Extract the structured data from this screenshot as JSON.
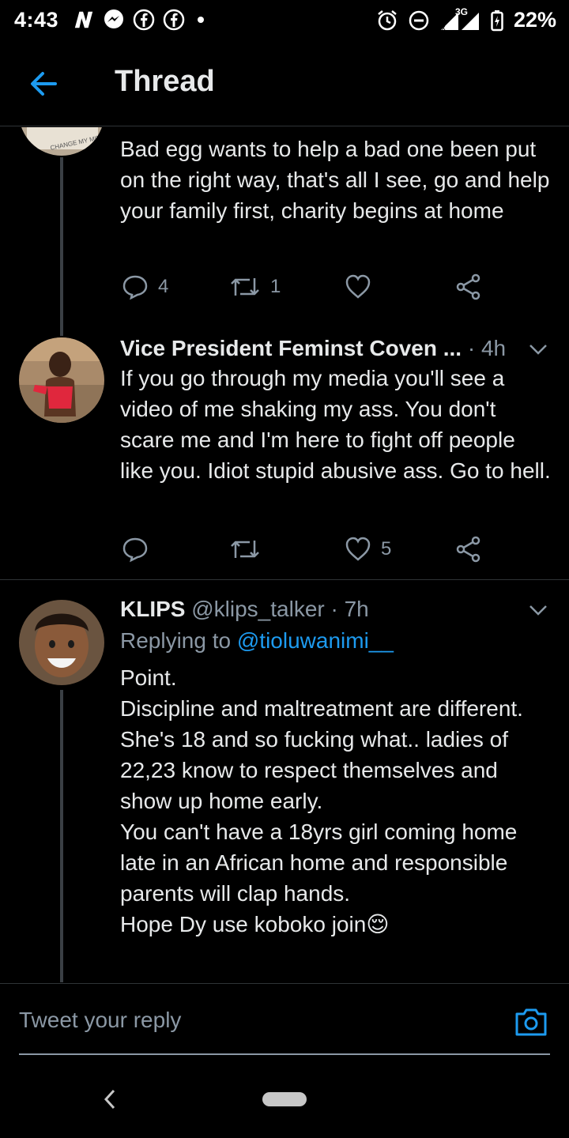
{
  "status_bar": {
    "time": "4:43",
    "network": "3G",
    "battery": "22%",
    "left_icons": [
      "n-notification-icon",
      "messenger-icon",
      "facebook-icon",
      "facebook-icon"
    ],
    "right_icons": [
      "alarm-icon",
      "dnd-icon",
      "signal-icon",
      "battery-icon"
    ]
  },
  "header": {
    "title": "Thread"
  },
  "tweets": [
    {
      "text": "Bad egg wants to help a bad one been put on the right way,  that's all I see,  go and help your family first, charity begins at home",
      "replies": "4",
      "retweets": "1",
      "likes": ""
    },
    {
      "name": "Vice President Feminst Coven ...",
      "meta": " · 4h",
      "text": "If you go through my media you'll see a video of me shaking my ass. You don't scare me and I'm here to fight off people like you. Idiot stupid abusive ass. Go to hell.",
      "replies": "",
      "retweets": "",
      "likes": "5"
    },
    {
      "name": "KLIPS",
      "meta": " @klips_talker · 7h",
      "replying_prefix": "Replying to ",
      "replying_to": "@tioluwanimi__",
      "lines": [
        "Point.",
        "Discipline and maltreatment are different.",
        "She's 18 and so fucking what.. ladies of 22,23 know to respect themselves and show up home early.",
        "You can't have a 18yrs girl coming home late in an African home and  responsible parents will clap hands.",
        "Hope Dy use koboko join😌"
      ]
    }
  ],
  "reply_bar": {
    "placeholder": "Tweet your reply"
  },
  "colors": {
    "accent": "#1d9bf0",
    "background": "#000000",
    "muted": "#8b98a5"
  }
}
